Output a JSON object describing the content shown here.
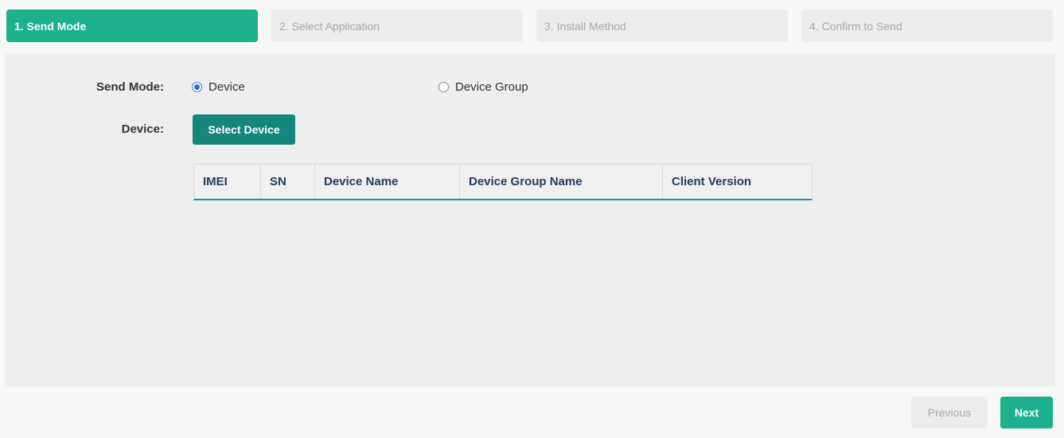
{
  "steps": [
    {
      "label": "1. Send Mode",
      "active": true
    },
    {
      "label": "2. Select Application",
      "active": false
    },
    {
      "label": "3. Install Method",
      "active": false
    },
    {
      "label": "4. Confirm to Send",
      "active": false
    }
  ],
  "form": {
    "send_mode_label": "Send Mode:",
    "send_mode_options": [
      {
        "label": "Device",
        "checked": true
      },
      {
        "label": "Device Group",
        "checked": false
      }
    ],
    "device_label": "Device:",
    "select_device_button": "Select Device"
  },
  "table": {
    "columns": [
      "IMEI",
      "SN",
      "Device Name",
      "Device Group Name",
      "Client Version"
    ]
  },
  "footer": {
    "previous_label": "Previous",
    "next_label": "Next"
  },
  "colors": {
    "accent": "#1cb08c",
    "button_dark": "#14867c",
    "table_header_text": "#243a5e",
    "inactive_step_bg": "#ececec",
    "inactive_text": "#a9a9a9"
  }
}
